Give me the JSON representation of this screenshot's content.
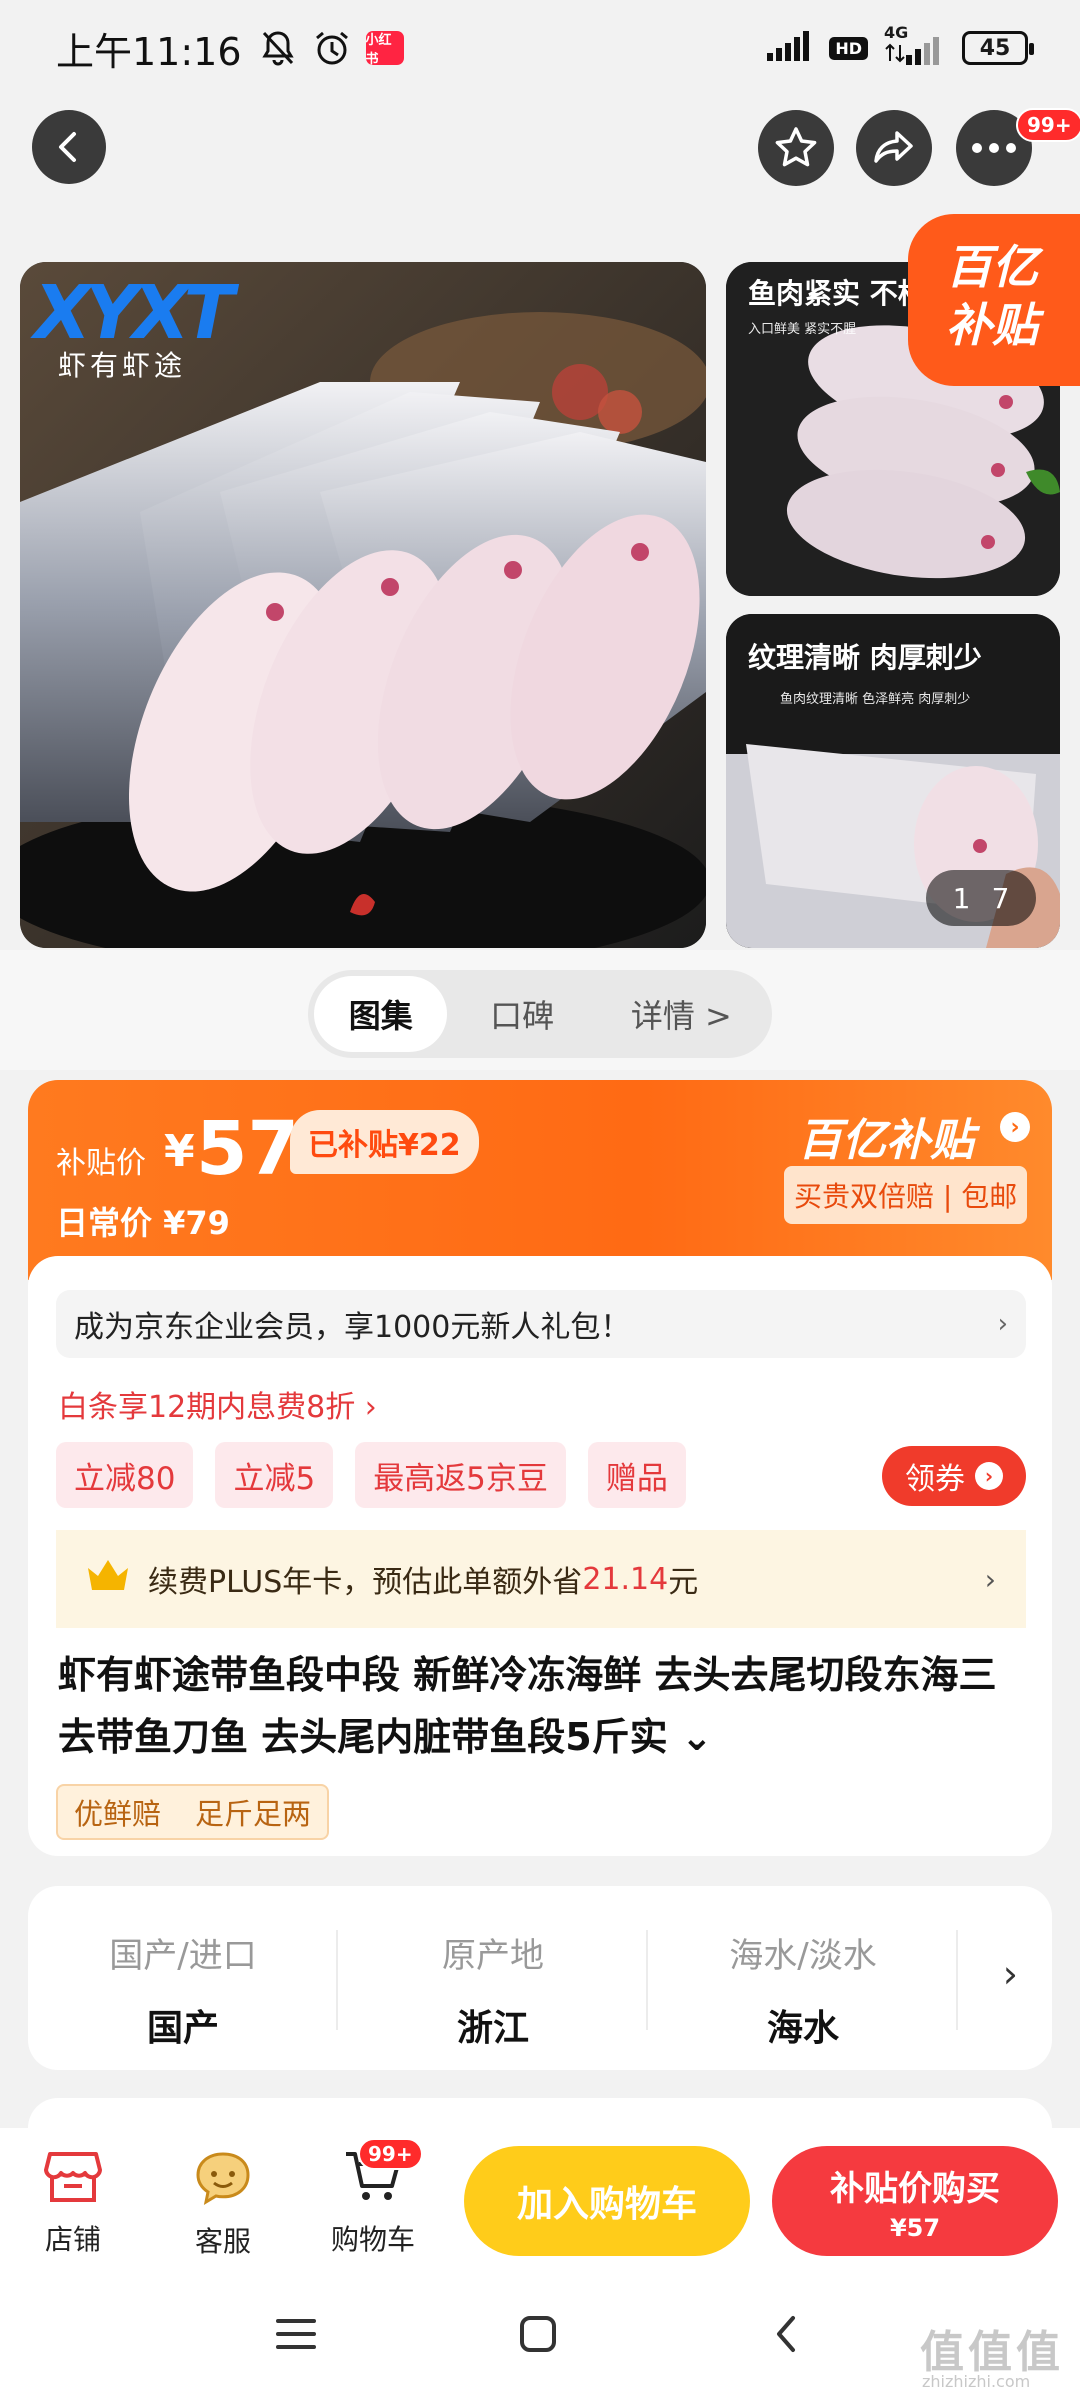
{
  "status_bar": {
    "time": "上午11:16",
    "xhs_badge": "小红书",
    "network": "4G",
    "hd": "HD",
    "battery": "45"
  },
  "top_bar": {
    "more_badge": "99+"
  },
  "gallery": {
    "brand_logo": "XYXT",
    "brand_sub": "虾有虾途",
    "thumb1_title": "鱼肉紧实 不松",
    "thumb1_sub": "入口鲜美 紧实不腥",
    "thumb2_title": "纹理清晰 肉厚刺少",
    "thumb2_sub": "鱼肉纹理清晰 色泽鲜亮 肉厚刺少",
    "subsidy_corner": "百亿补贴",
    "page_current": "1",
    "page_total": "7"
  },
  "tabs": [
    {
      "label": "图集"
    },
    {
      "label": "口碑"
    },
    {
      "label": "详情 >"
    }
  ],
  "price": {
    "label": "补贴价",
    "yen": "¥",
    "value": "57",
    "saved": "已补贴¥22",
    "daily": "日常价 ¥79",
    "subsidy_logo": "百亿补贴",
    "subsidy_tagline": "买贵双倍赔 | 包邮"
  },
  "card": {
    "member_text": "成为京东企业会员，享1000元新人礼包！",
    "baitiao_text": "白条享12期内息费8折 ›",
    "promos": [
      "立减80",
      "立减5",
      "最高返5京豆",
      "赠品"
    ],
    "coupon_label": "领券",
    "plus_text": "续费PLUS年卡，预估此单额外省",
    "plus_amount": "21.14",
    "plus_unit": "元",
    "title": "虾有虾途带鱼段中段 新鲜冷冻海鲜 去头去尾切段东海三去带鱼刀鱼 去头尾内脏带鱼段5斤实 ⌄",
    "guarantee": [
      "优鲜赔",
      "足斤足两"
    ]
  },
  "attributes": [
    {
      "label": "国产/进口",
      "value": "国产"
    },
    {
      "label": "原产地",
      "value": "浙江"
    },
    {
      "label": "海水/淡水",
      "value": "海水"
    }
  ],
  "bottom_bar": {
    "shop": "店铺",
    "service": "客服",
    "cart": "购物车",
    "cart_badge": "99+",
    "add_cart": "加入购物车",
    "buy_now": "补贴价购买",
    "buy_price": "¥57"
  },
  "watermark": {
    "text": "值值值",
    "sub": "zhizhizhi.com"
  },
  "colors": {
    "accent_orange": "#ff6a14",
    "jd_red": "#e4393c",
    "add_cart_yellow": "#ffcc1a",
    "buy_red": "#f53a3f"
  }
}
